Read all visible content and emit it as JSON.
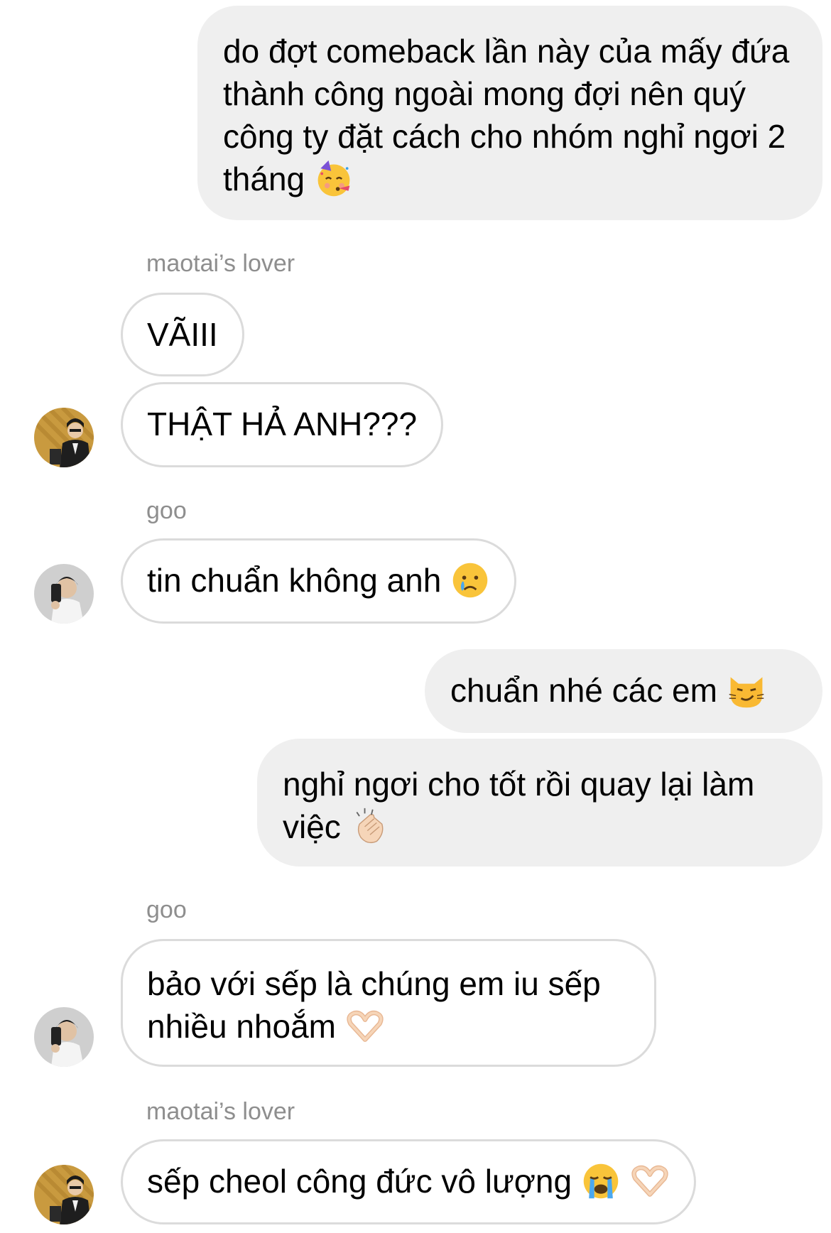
{
  "messages": [
    {
      "text": "do đợt comeback lần này của mấy đứa thành công ngoài mong đợi nên quý công ty đặt cách cho nhóm nghỉ ngơi 2 tháng",
      "emoji": [
        "partying-face-icon"
      ]
    },
    {
      "sender": "maotai’s lover",
      "text": "VÃIII"
    },
    {
      "text": "THẬT HẢ ANH???"
    },
    {
      "sender": "goo",
      "text": "tin chuẩn không anh",
      "emoji": [
        "crying-face-icon"
      ]
    },
    {
      "text": "chuẩn nhé các em",
      "emoji": [
        "smirking-cat-icon"
      ]
    },
    {
      "text": "nghỉ ngơi cho tốt rồi quay lại làm việc",
      "emoji": [
        "clapping-hands-icon"
      ]
    },
    {
      "sender": "goo",
      "text": "bảo với sếp là chúng em iu sếp nhiều nhoắm",
      "emoji": [
        "heart-hands-icon"
      ]
    },
    {
      "sender": "maotai’s lover",
      "text": "sếp cheol công đức vô lượng",
      "emoji": [
        "loudly-crying-face-icon",
        "heart-hands-icon"
      ]
    }
  ],
  "colors": {
    "outgoing_bubble": "#efefef",
    "incoming_border": "#dbdbdb",
    "sender_name": "#8e8e8e"
  }
}
